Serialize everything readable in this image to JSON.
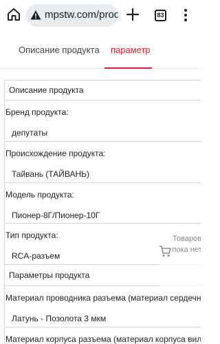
{
  "browser": {
    "url": "mpstw.com/prod",
    "tab_count": "83"
  },
  "tabs": [
    {
      "label": "Описание продукта",
      "active": false
    },
    {
      "label": "параметр",
      "active": true
    }
  ],
  "colors": {
    "accent": "#d9232d",
    "border": "#d4d4d4",
    "url_bar": "#e9edf2"
  },
  "table": {
    "section_description": "Описание продукта",
    "brand_label": "Бренд продукта:",
    "brand_value": "депутаты",
    "origin_label": "Происхождение продукта:",
    "origin_value": "Тайвань (ТАЙВАНЬ)",
    "model_label": "Модель продукта:",
    "model_value": "Пионер-8Г/Пионер-10Г",
    "type_label": "Тип продукта:",
    "type_value": "RCA-разъем",
    "section_params": "Параметры продукта",
    "conductor_label": "Материал проводника разъема (материал сердечни",
    "conductor_value": "Латунь - Позолота 3 мкм",
    "housing_label": "Материал корпуса разъема (материал корпуса вилк"
  },
  "cart_float": {
    "text": "Товаров пока нет"
  }
}
